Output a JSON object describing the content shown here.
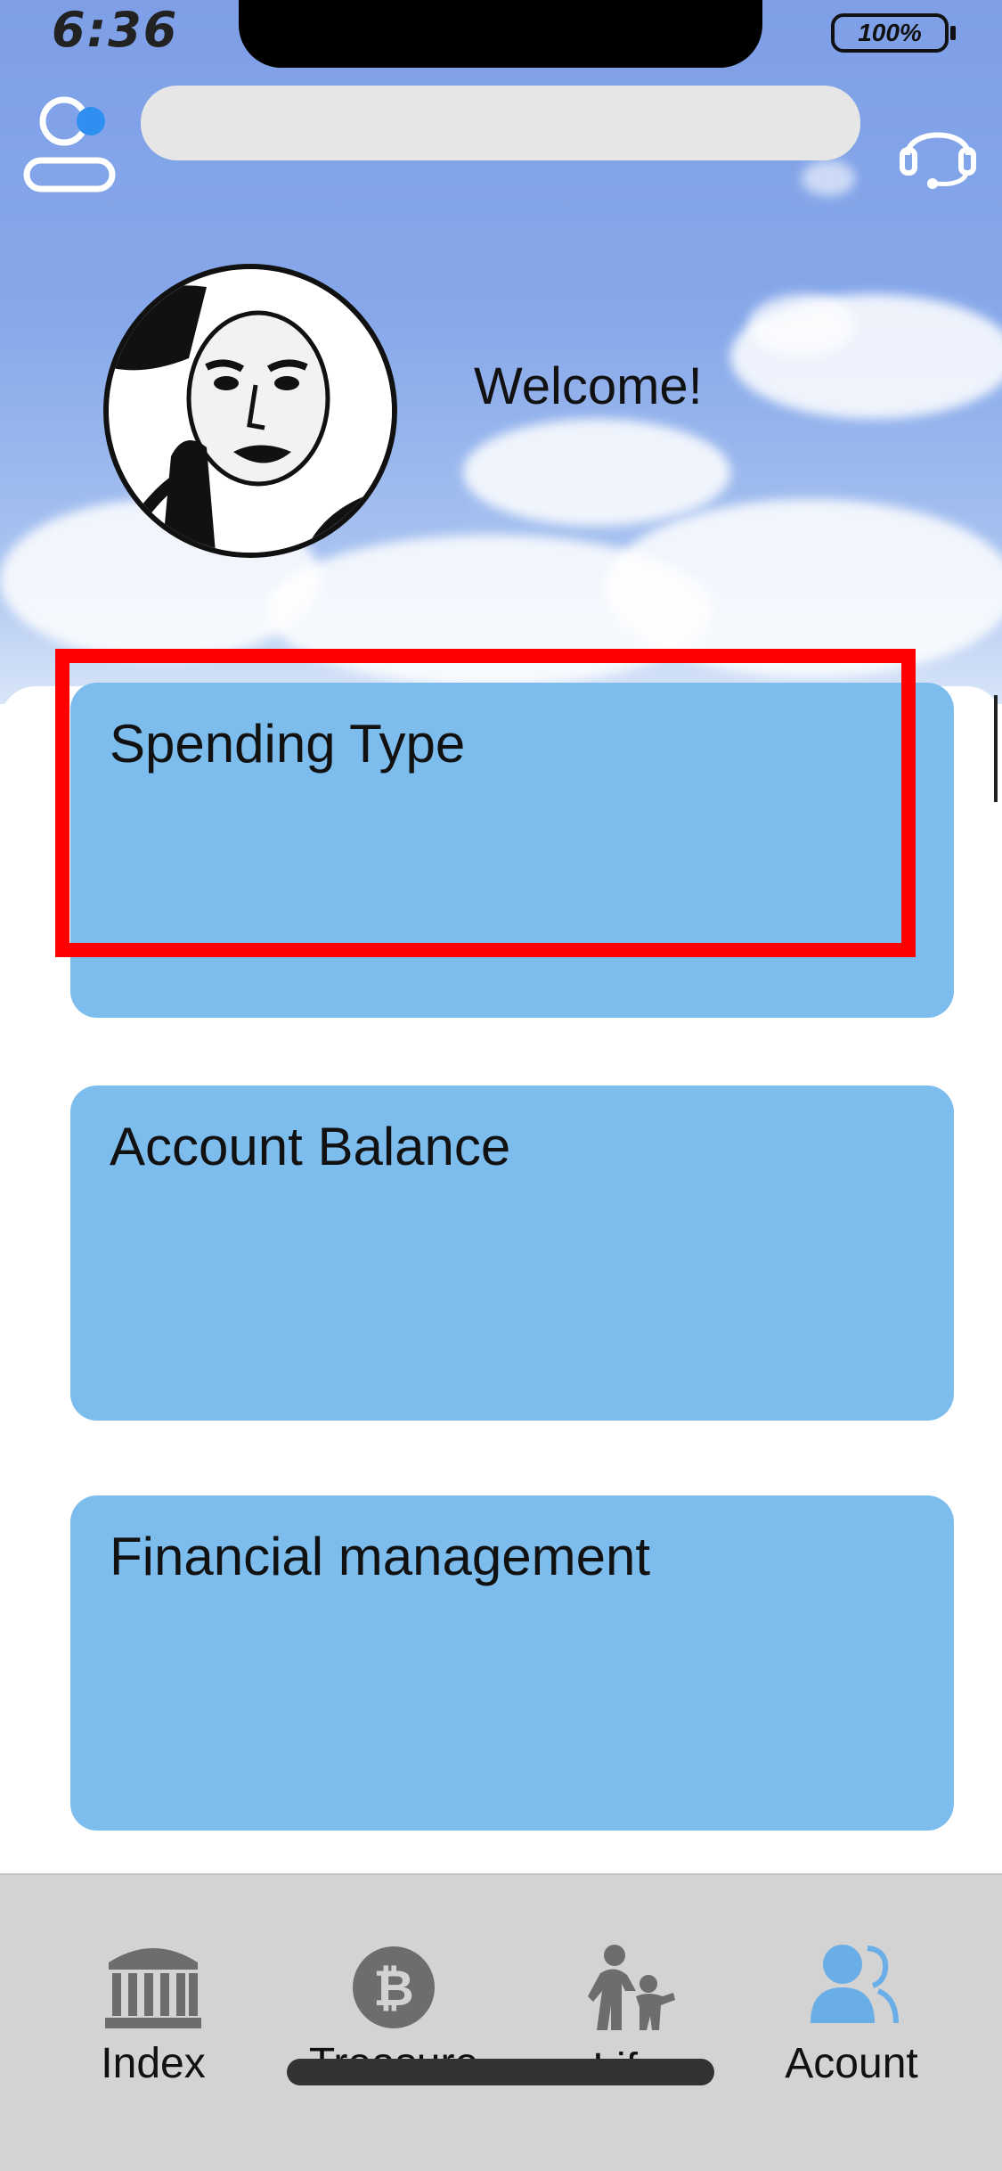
{
  "status_bar": {
    "time": "6:36",
    "battery": "100%"
  },
  "header": {
    "search": {
      "placeholder": ""
    },
    "welcome_text": "Welcome!"
  },
  "cards": [
    {
      "title": "Spending Type",
      "highlighted": true
    },
    {
      "title": "Account Balance",
      "highlighted": false
    },
    {
      "title": "Financial management",
      "highlighted": false
    }
  ],
  "tab_bar": {
    "tabs": [
      {
        "label": "Index",
        "icon": "bank-icon",
        "active": false
      },
      {
        "label": "Treasure",
        "icon": "bitcoin-icon",
        "active": false
      },
      {
        "label": "Life",
        "icon": "family-icon",
        "active": false
      },
      {
        "label": "Acount",
        "icon": "users-icon",
        "active": true
      }
    ]
  },
  "colors": {
    "card": "#7dbdee",
    "highlight": "#ff0000",
    "tab_icon": "#6d6d6d",
    "tab_icon_active": "#6aaee8",
    "tab_bar": "#d3d3d3"
  }
}
